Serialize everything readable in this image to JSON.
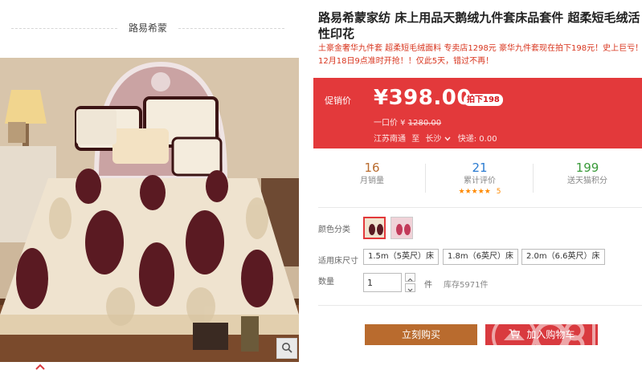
{
  "shop": {
    "name": "路易希蒙"
  },
  "product": {
    "title": "路易希蒙家纺 床上用品天鹅绒九件套床品套件 超柔短毛绒活性印花",
    "subtitle": "土豪金奢华九件套 超柔短毛绒面料 专卖店1298元 豪华九件套现在拍下198元！史上巨亏！12月18日9点准时开抢！！仅此5天，错过不再！"
  },
  "price": {
    "promo_label": "促销价",
    "current": "¥398.00",
    "tag": "拍下198",
    "origin_label": "一口价 ¥",
    "origin_value": "1280.00",
    "ship_from": "江苏南通",
    "ship_to_word": "至",
    "ship_to": "长沙",
    "express": "快递: 0.00"
  },
  "stats": [
    {
      "value": "16",
      "label": "月销量",
      "color": "#b96b2e"
    },
    {
      "value": "21",
      "label": "累计评价",
      "color": "#2a7bd1",
      "stars": "★★★★★",
      "rating": "5"
    },
    {
      "value": "199",
      "label": "送天猫积分",
      "color": "#3a9a3a"
    }
  ],
  "options": {
    "color_label": "颜色分类",
    "size_label": "适用床尺寸",
    "sizes": [
      "1.5m（5英尺）床",
      "1.8m（6英尺）床",
      "2.0m（6.6英尺）床"
    ],
    "qty_label": "数量",
    "qty_value": "1",
    "qty_unit": "件",
    "stock": "库存5971件"
  },
  "actions": {
    "buy": "立刻购买",
    "cart": "加入购物车"
  },
  "watermark": {
    "text": "08家"
  },
  "colors": {
    "accent": "#e3393b",
    "buy": "#b96b2e",
    "cart": "#d93a3f"
  },
  "icons": [
    "zoom-icon",
    "chevron-up-icon",
    "chevron-down-icon",
    "cart-icon"
  ]
}
